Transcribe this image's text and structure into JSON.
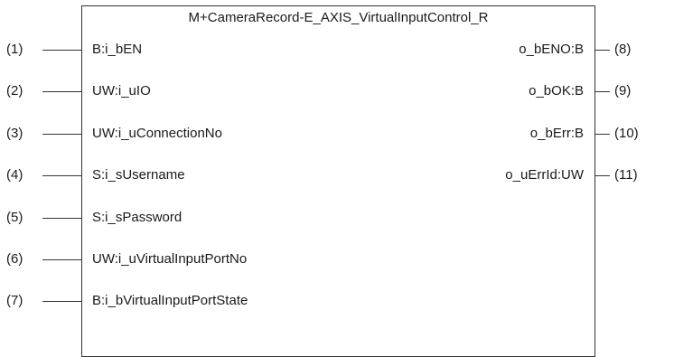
{
  "block": {
    "title": "M+CameraRecord-E_AXIS_VirtualInputControl_R"
  },
  "inputs": [
    {
      "num": "(1)",
      "label": "B:i_bEN"
    },
    {
      "num": "(2)",
      "label": "UW:i_uIO"
    },
    {
      "num": "(3)",
      "label": "UW:i_uConnectionNo"
    },
    {
      "num": "(4)",
      "label": "S:i_sUsername"
    },
    {
      "num": "(5)",
      "label": "S:i_sPassword"
    },
    {
      "num": "(6)",
      "label": "UW:i_uVirtualInputPortNo"
    },
    {
      "num": "(7)",
      "label": "B:i_bVirtualInputPortState"
    }
  ],
  "outputs": [
    {
      "num": "(8)",
      "label": "o_bENO:B"
    },
    {
      "num": "(9)",
      "label": "o_bOK:B"
    },
    {
      "num": "(10)",
      "label": "o_bErr:B"
    },
    {
      "num": "(11)",
      "label": "o_uErrId:UW"
    }
  ]
}
